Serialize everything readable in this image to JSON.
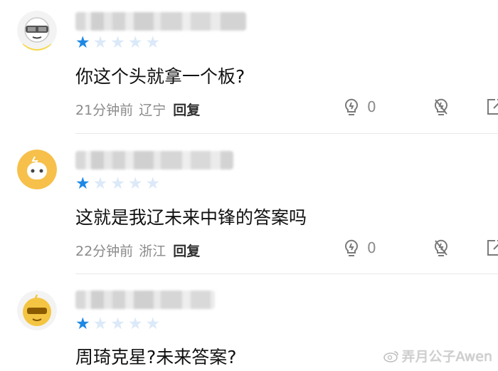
{
  "comments": [
    {
      "rating": 1,
      "text": "你这个头就拿一个板?",
      "time": "21分钟前",
      "location": "辽宁",
      "reply_label": "回复",
      "like_count": "0",
      "avatar_color": "#f6b33f"
    },
    {
      "rating": 1,
      "text": "这就是我辽未来中锋的答案吗",
      "time": "22分钟前",
      "location": "浙江",
      "reply_label": "回复",
      "like_count": "0",
      "avatar_color": "#f6c04a"
    },
    {
      "rating": 1,
      "text": "周琦克星?未来答案?",
      "avatar_color": "#f4c542"
    }
  ],
  "watermark": "弄月公子Awen",
  "colors": {
    "star_on": "#1e88e5",
    "star_off": "#dbe9f8"
  }
}
